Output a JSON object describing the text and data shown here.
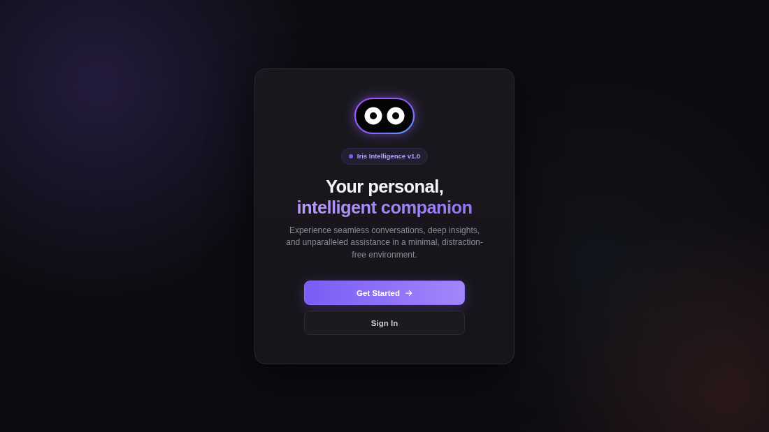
{
  "badge": {
    "label": "Iris Intelligence v1.0"
  },
  "heading": {
    "line_1": "Your personal,",
    "line_2": "intelligent companion"
  },
  "description": "Experience seamless conversations, deep insights, and unparalleled assistance in a minimal, distraction-free environment.",
  "buttons": [
    {
      "label": "Get Started",
      "kind": "primary"
    },
    {
      "label": "Sign In",
      "kind": "secondary"
    }
  ]
}
